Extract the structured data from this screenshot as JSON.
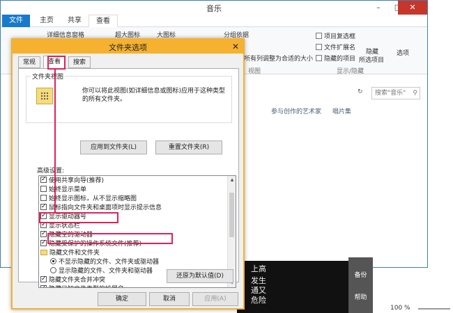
{
  "explorer": {
    "title": "音乐",
    "tabs": [
      "文件",
      "主页",
      "共享",
      "查看"
    ],
    "ribbon": {
      "layout_items": [
        "详细信息窗格",
        "超大图标",
        "大图标"
      ],
      "group_by": "分组依据",
      "fit_columns": "将所有列调整为合适的大小",
      "view_group": "视图",
      "checks": [
        {
          "label": "项目复选框",
          "checked": false
        },
        {
          "label": "文件扩展名",
          "checked": false
        },
        {
          "label": "隐藏的项目",
          "checked": false
        }
      ],
      "hide_selected": "隐藏",
      "hide_selected_2": "所选项目",
      "show_hide_group": "显示/隐藏",
      "options": "选项"
    },
    "search_placeholder": "搜索\"音乐\"",
    "columns": [
      "参与创作的艺术家",
      "唱片集"
    ]
  },
  "background": {
    "dark_lines": [
      "上高",
      "发生",
      "通又",
      "危险"
    ],
    "side_labels": [
      "备份",
      "帮助"
    ],
    "zoom": "100 %"
  },
  "dialog": {
    "title": "文件夹选项",
    "tabs": [
      "常规",
      "查看",
      "搜索"
    ],
    "folder_views": {
      "legend": "文件夹视图",
      "description": "你可以将此视图(如详细信息或图标)应用于这种类型的所有文件夹。",
      "apply_button": "应用到文件夹(L)",
      "reset_button": "重置文件夹(R)"
    },
    "advanced_label": "高级设置:",
    "settings": [
      {
        "type": "check",
        "checked": true,
        "label": "使用共享向导(推荐)"
      },
      {
        "type": "check",
        "checked": false,
        "label": "始终显示菜单"
      },
      {
        "type": "check",
        "checked": false,
        "label": "始终显示图标，从不显示缩略图"
      },
      {
        "type": "check",
        "checked": true,
        "label": "鼠标指向文件夹和桌面项时显示提示信息"
      },
      {
        "type": "check",
        "checked": true,
        "label": "显示驱动器号"
      },
      {
        "type": "check",
        "checked": true,
        "label": "显示状态栏"
      },
      {
        "type": "check",
        "checked": true,
        "label": "隐藏空的驱动器"
      },
      {
        "type": "check",
        "checked": true,
        "label": "隐藏受保护的操作系统文件(推荐)"
      },
      {
        "type": "folder",
        "label": "隐藏文件和文件夹"
      },
      {
        "type": "radio",
        "checked": true,
        "label": "不显示隐藏的文件、文件夹或驱动器"
      },
      {
        "type": "radio",
        "checked": false,
        "label": "显示隐藏的文件、文件夹和驱动器"
      },
      {
        "type": "check",
        "checked": true,
        "label": "隐藏文件夹合并冲突"
      },
      {
        "type": "check",
        "checked": true,
        "label": "隐藏已知文件类型的扩展名"
      }
    ],
    "restore_button": "还原为默认值(D)",
    "ok_button": "确定",
    "cancel_button": "取消",
    "apply_button": "应用(A)"
  }
}
